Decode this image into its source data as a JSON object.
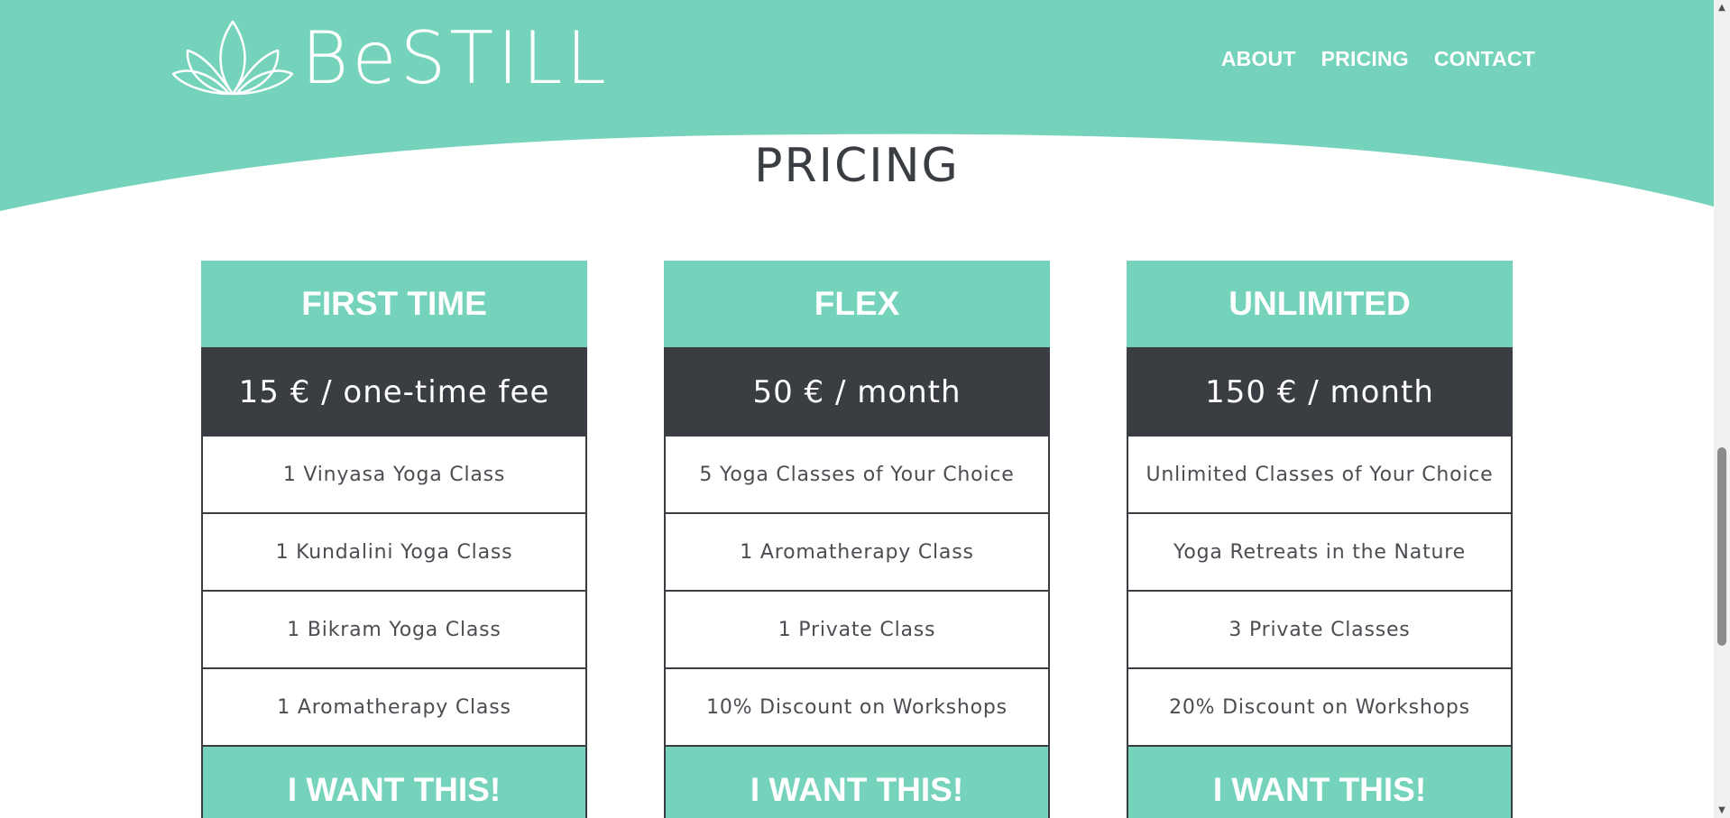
{
  "brand": {
    "name": "BeSTILL",
    "logo_icon": "lotus-icon",
    "accent_color": "#74d3ba",
    "dark_color": "#3a3d42"
  },
  "nav": {
    "items": [
      {
        "label": "ABOUT"
      },
      {
        "label": "PRICING"
      },
      {
        "label": "CONTACT"
      }
    ]
  },
  "pricing": {
    "title": "PRICING",
    "plans": [
      {
        "name": "FIRST TIME",
        "price": "15 € / one-time fee",
        "features": [
          "1 Vinyasa Yoga Class",
          "1 Kundalini Yoga Class",
          "1 Bikram Yoga Class",
          "1 Aromatherapy Class"
        ],
        "cta": "I WANT THIS!"
      },
      {
        "name": "FLEX",
        "price": "50 € / month",
        "features": [
          "5 Yoga Classes of Your Choice",
          "1 Aromatherapy Class",
          "1 Private Class",
          "10% Discount on Workshops"
        ],
        "cta": "I WANT THIS!"
      },
      {
        "name": "UNLIMITED",
        "price": "150 € / month",
        "features": [
          "Unlimited Classes of Your Choice",
          "Yoga Retreats in the Nature",
          "3 Private Classes",
          "20% Discount on Workshops"
        ],
        "cta": "I WANT THIS!"
      }
    ]
  },
  "scrollbar": {
    "up_icon": "scroll-up-arrow-icon",
    "down_icon": "scroll-down-arrow-icon"
  }
}
